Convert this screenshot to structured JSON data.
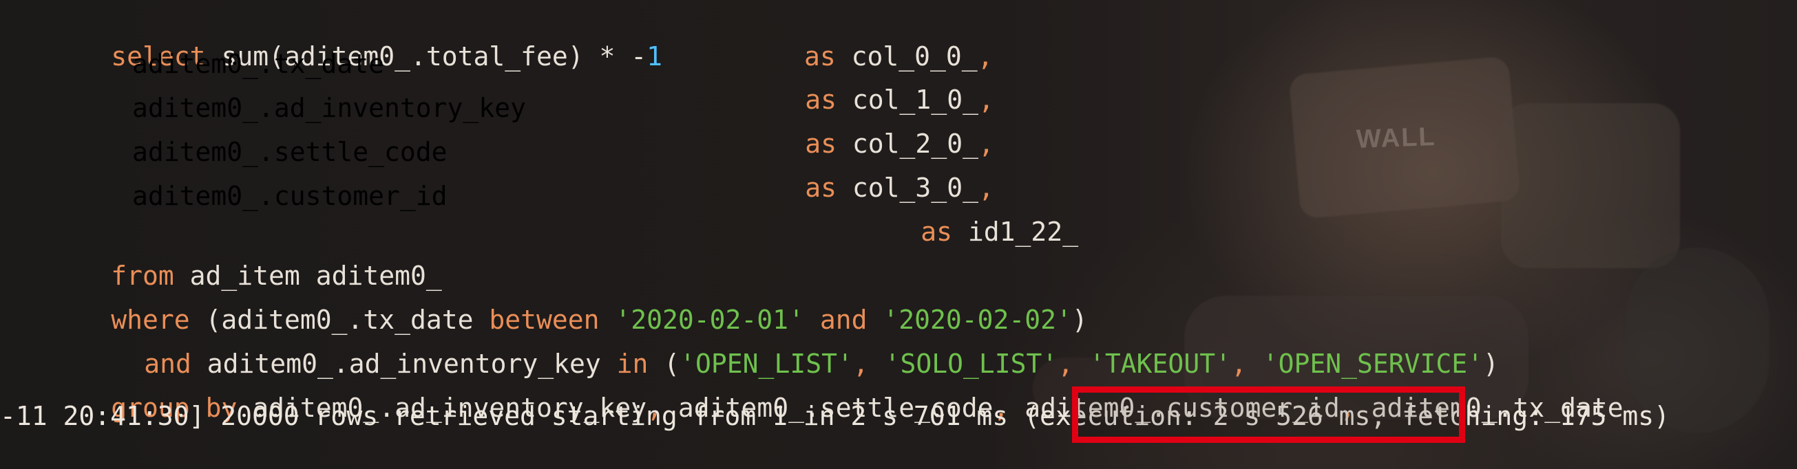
{
  "sql": {
    "line1": {
      "kw": "select",
      "expr": " sum(aditem0_.total_fee) * -",
      "num": "1",
      "spacer": "         ",
      "as": "as",
      "alias": " col_0_0_",
      "comma": ","
    },
    "line2": {
      "expr": "aditem0_.tx_date",
      "as": "as",
      "alias": " col_1_0_",
      "comma": ","
    },
    "line3": {
      "expr": "aditem0_.ad_inventory_key",
      "as": "as",
      "alias": " col_2_0_",
      "comma": ","
    },
    "line4": {
      "expr": "aditem0_.settle_code",
      "as": "as",
      "alias": " col_3_0_",
      "comma": ","
    },
    "line5": {
      "expr": "aditem0_.customer_id",
      "as": "as",
      "alias": " id1_22_"
    },
    "line6": {
      "kw": "from",
      "text": " ad_item aditem0_"
    },
    "line7": {
      "kw": "where",
      "text1": " (aditem0_.tx_date ",
      "kw2": "between",
      "space": " ",
      "str1": "'2020-02-01'",
      "kw3": " and ",
      "str2": "'2020-02-02'",
      "close": ")"
    },
    "line8": {
      "kw": "and",
      "text1": " aditem0_.ad_inventory_key ",
      "kw2": "in",
      "text2": " (",
      "str1": "'OPEN_LIST'",
      "comma1": ", ",
      "str2": "'SOLO_LIST'",
      "comma2": ", ",
      "str3": "'TAKEOUT'",
      "comma3": ", ",
      "str4": "'OPEN_SERVICE'",
      "close": ")"
    },
    "line9": {
      "kw1": "group",
      "space": " ",
      "kw2": "by",
      "text1": " aditem0_.ad_inventory_key",
      "comma1": ",",
      "text2": " aditem0_.settle_code",
      "comma2": ",",
      "text3": " aditem0_.customer_id",
      "comma3": ",",
      "text4": " aditem0_.tx_date"
    }
  },
  "status": {
    "text": "-11 20:41:30] 20000 rows retrieved starting from 1 in 2 s 701 ms (execution: 2 s 526 ms, fetching: 175 ms)"
  },
  "background": {
    "label": "WALL"
  }
}
